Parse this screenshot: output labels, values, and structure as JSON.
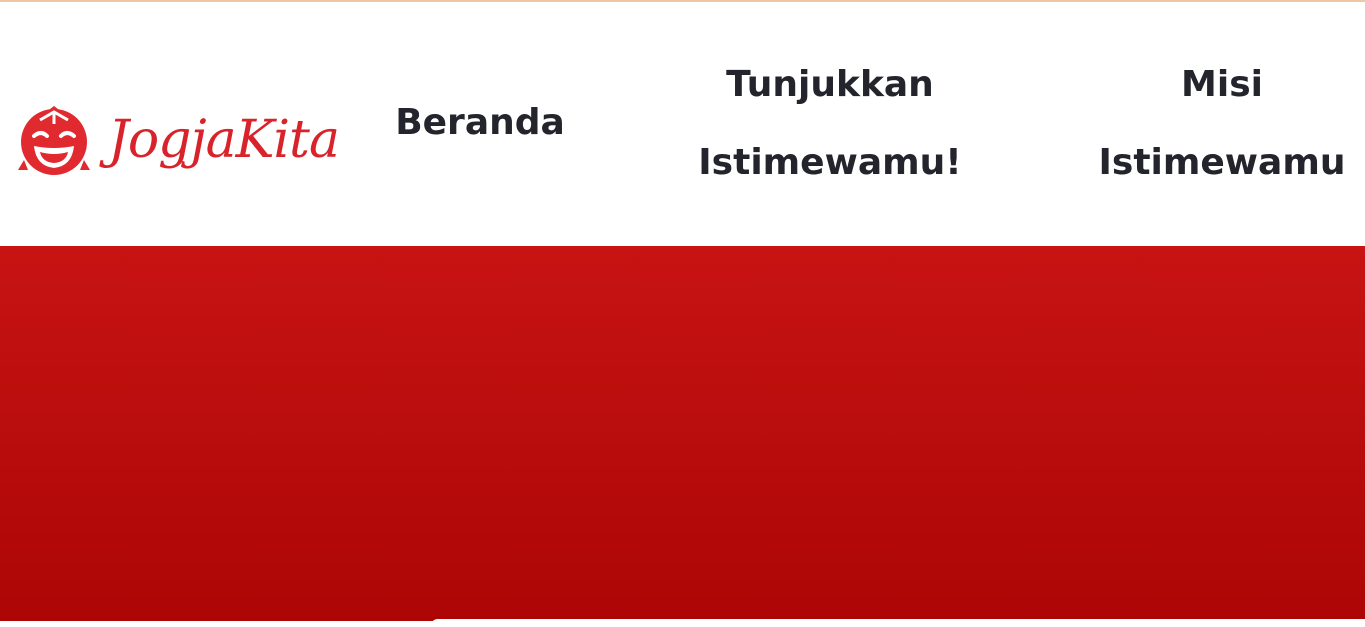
{
  "brand": {
    "name": "JogjaKita",
    "logo_icon": "laughing-face-logo-icon",
    "accent_color": "#d9232b"
  },
  "nav": {
    "items": [
      {
        "lines": [
          "Beranda"
        ]
      },
      {
        "lines": [
          "Tunjukkan",
          "Istimewamu!"
        ]
      },
      {
        "lines": [
          "Misi",
          "Istimewamu"
        ]
      }
    ]
  },
  "hero": {
    "background_top": "#c81313",
    "background_bottom": "#ad0505"
  }
}
